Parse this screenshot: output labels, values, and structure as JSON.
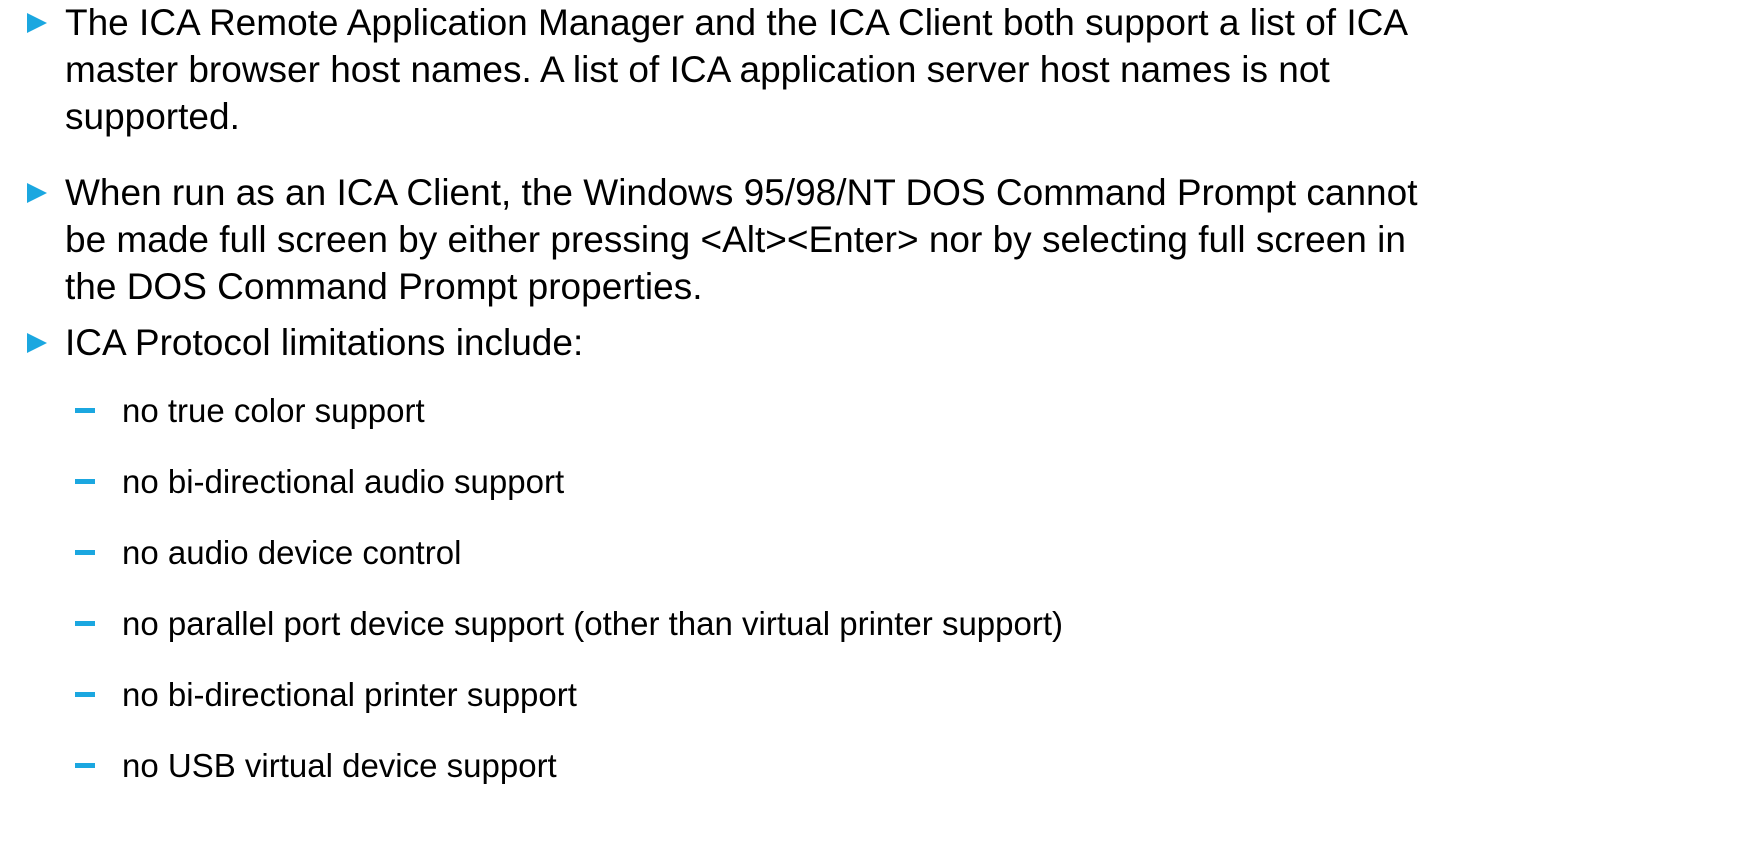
{
  "bullets": [
    {
      "lines": [
        "The ICA Remote Application Manager and the ICA Client both support a list of ICA",
        "master browser host names. A list of ICA application server host names is not",
        "supported."
      ]
    },
    {
      "lines": [
        "When run as an ICA Client, the Windows 95/98/NT DOS Command Prompt cannot",
        "be made full screen by either pressing <Alt><Enter> nor by selecting full screen in",
        "the DOS Command Prompt properties."
      ]
    },
    {
      "lines": [
        "ICA Protocol limitations include:"
      ]
    }
  ],
  "sub_bullets": [
    "no true color support",
    "no bi-directional audio support",
    "no audio device control",
    "no parallel port device support (other than virtual printer support)",
    "no bi-directional printer support",
    "no USB virtual device support"
  ],
  "colors": {
    "bullet_marker": "#1ba7e0",
    "text": "#000000",
    "background": "#ffffff"
  },
  "icons": {
    "bullet": "triangle-right-icon",
    "sub_bullet": "dash-icon"
  }
}
